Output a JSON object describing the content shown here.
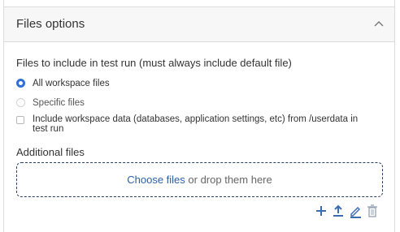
{
  "panel": {
    "title": "Files options"
  },
  "include": {
    "label": "Files to include in test run (must always include default file)",
    "options": [
      {
        "label": "All workspace files",
        "selected": true
      },
      {
        "label": "Specific files",
        "selected": false
      }
    ],
    "workspace_data_line1": "Include workspace data (databases, application settings, etc) from /userdata in",
    "workspace_data_line2": "test run"
  },
  "additional": {
    "label": "Additional files",
    "choose_link": "Choose files",
    "drop_text": " or drop them here"
  },
  "toolbar": {
    "icons": [
      "plus-icon",
      "upload-icon",
      "edit-icon",
      "trash-icon"
    ]
  },
  "colors": {
    "accent": "#2f6fd6",
    "link": "#2b5fa6",
    "toolbar_icon": "#3b6bb0"
  }
}
